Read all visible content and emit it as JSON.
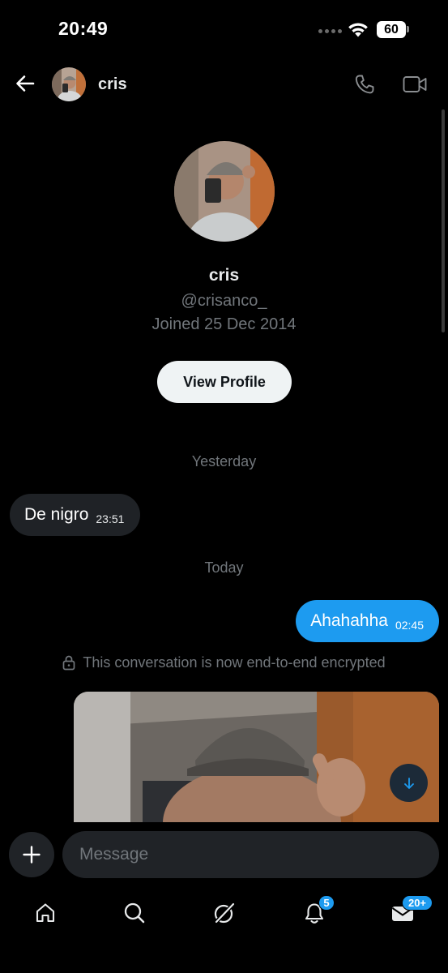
{
  "status_bar": {
    "time": "20:49",
    "battery": "60"
  },
  "header": {
    "name": "cris"
  },
  "profile": {
    "name": "cris",
    "handle": "@crisanco_",
    "joined": "Joined 25 Dec 2014",
    "view_profile_label": "View Profile"
  },
  "conversation": {
    "day_yesterday": "Yesterday",
    "day_today": "Today",
    "messages": [
      {
        "direction": "incoming",
        "text": "De nigro",
        "time": "23:51"
      },
      {
        "direction": "outgoing",
        "text": "Ahahahha",
        "time": "02:45"
      }
    ],
    "encrypted_notice": "This conversation is now end-to-end encrypted"
  },
  "composer": {
    "placeholder": "Message"
  },
  "tab_bar": {
    "items": [
      {
        "name": "home-icon"
      },
      {
        "name": "search-icon"
      },
      {
        "name": "grok-icon"
      },
      {
        "name": "notifications-icon",
        "badge": "5"
      },
      {
        "name": "messages-icon",
        "badge": "20+"
      }
    ]
  },
  "colors": {
    "accent": "#1d9bf0",
    "background": "#000000",
    "incoming_bubble": "#1f2226",
    "secondary_text": "#71767b"
  }
}
